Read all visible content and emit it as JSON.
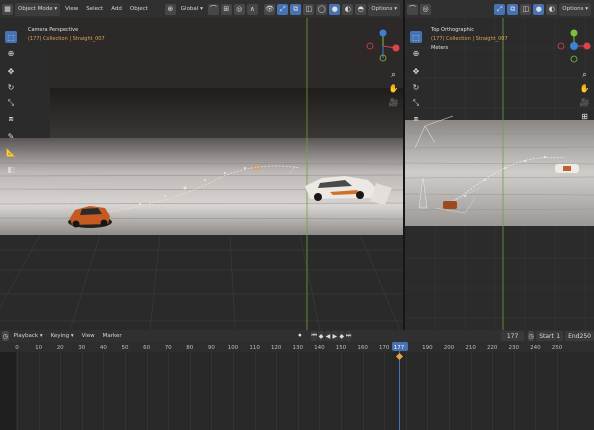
{
  "header": {
    "mode": "Object Mode",
    "menu": [
      "View",
      "Select",
      "Add",
      "Object"
    ],
    "orientation": "Global",
    "options": "Options"
  },
  "left_viewport": {
    "view_name": "Camera Perspective",
    "collection": "(177) Collection | Straight_007"
  },
  "right_viewport": {
    "view_name": "Top Orthographic",
    "collection": "(177) Collection | Straight_007",
    "units": "Meters",
    "options": "Options"
  },
  "timeline": {
    "playback": "Playback",
    "keying": "Keying",
    "view": "View",
    "marker": "Marker",
    "current_frame": "177",
    "start_label": "Start",
    "start_value": "1",
    "end_label": "End",
    "end_value": "250",
    "ticks": [
      "0",
      "10",
      "20",
      "30",
      "40",
      "50",
      "60",
      "70",
      "80",
      "90",
      "100",
      "110",
      "120",
      "130",
      "140",
      "150",
      "160",
      "170",
      "177",
      "190",
      "200",
      "210",
      "220",
      "230",
      "240",
      "250"
    ]
  },
  "colors": {
    "accent": "#4772b3",
    "playhead": "#4772b3",
    "axis_x": "#e0414d",
    "axis_y": "#7fbf3f",
    "axis_z": "#3f7fd6"
  },
  "icons": [
    "cursor-icon",
    "move-icon",
    "rotate-icon",
    "scale-icon",
    "transform-icon",
    "annotate-icon",
    "measure-icon",
    "add-cube-icon",
    "zoom-icon",
    "hand-icon",
    "camera-icon",
    "grid-icon"
  ]
}
